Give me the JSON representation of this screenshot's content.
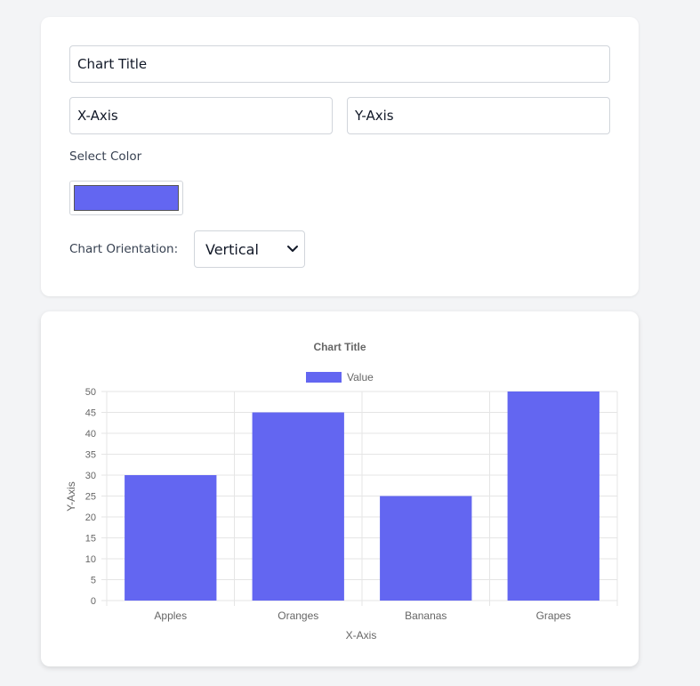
{
  "controls": {
    "title_value": "Chart Title",
    "xaxis_value": "X-Axis",
    "yaxis_value": "Y-Axis",
    "color_label": "Select Color",
    "selected_color": "#6366f1",
    "orientation_label": "Chart Orientation:",
    "orientation_value": "Vertical",
    "orientation_icon": "chevron-down-icon"
  },
  "chart_data": {
    "type": "bar",
    "title": "Chart Title",
    "xlabel": "X-Axis",
    "ylabel": "Y-Axis",
    "categories": [
      "Apples",
      "Oranges",
      "Bananas",
      "Grapes"
    ],
    "series": [
      {
        "name": "Value",
        "values": [
          30,
          45,
          25,
          50
        ]
      }
    ],
    "ylim": [
      0,
      50
    ],
    "yticks": [
      0,
      5,
      10,
      15,
      20,
      25,
      30,
      35,
      40,
      45,
      50
    ],
    "grid": true,
    "legend": "top-center",
    "colors": {
      "bar": "#6366f1",
      "grid": "#e5e5e5",
      "text": "#666666"
    }
  }
}
